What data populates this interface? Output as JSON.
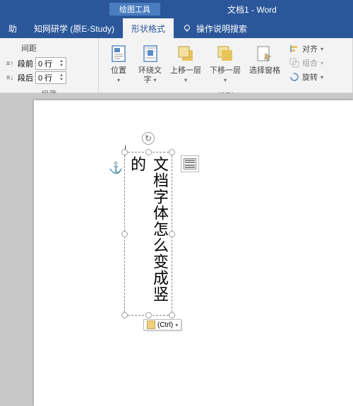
{
  "titlebar": {
    "tool_context": "绘图工具",
    "doc_title": "文档1 - Word"
  },
  "tabs": {
    "help_partial": "助",
    "estudy": "知网研学 (原E-Study)",
    "format": "形状格式",
    "tell_me": "操作说明搜索"
  },
  "ribbon": {
    "spacing": {
      "title": "间距",
      "before_label": "段前",
      "before_value": "0 行",
      "after_label": "段后",
      "after_value": "0 行",
      "group": "段落"
    },
    "arrange": {
      "position": "位置",
      "wrap": "环绕文\n字",
      "bring_fwd": "上移一层",
      "send_back": "下移一层",
      "selection": "选择窗格",
      "align": "对齐",
      "group_btn": "组合",
      "rotate": "旋转",
      "group": "排列"
    }
  },
  "shape": {
    "text": "文档字体怎么变成竖的"
  },
  "ctrl_tag": "(Ctrl)"
}
